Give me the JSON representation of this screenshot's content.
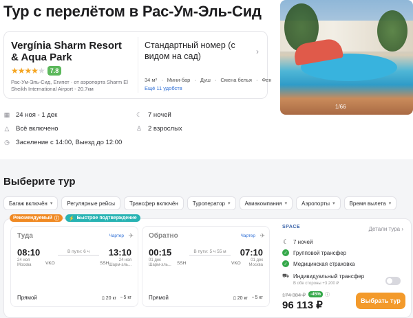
{
  "title": "Тур с перелётом в Рас-Ум-Эль-Сид",
  "hotel": {
    "name": "Vergínia Sharm Resort & Aqua Park",
    "stars": 4,
    "rating": "7.8",
    "location": "Рас-Ум-Эль-Сид, Египет · от аэропорта Sharm El Sheikh International Airport - 20.7км",
    "room": "Стандартный номер (с видом на сад)",
    "amenities": [
      "34 м²",
      "Мини-бар",
      "Душ",
      "Смена белья",
      "Фен"
    ],
    "more_amenities": "Ещё 11 удобств"
  },
  "photo_counter": "1/66",
  "facts": {
    "dates": "24 ноя - 1 дек",
    "meal": "Всё включено",
    "checkin": "Заселение с 14:00, Выезд до 12:00",
    "nights": "7 ночей",
    "guests": "2 взрослых"
  },
  "section_title": "Выберите тур",
  "filters": [
    {
      "label": "Багаж включён",
      "dropdown": true
    },
    {
      "label": "Регулярные рейсы",
      "dropdown": false
    },
    {
      "label": "Трансфер включён",
      "dropdown": false
    },
    {
      "label": "Туроператор",
      "dropdown": true
    },
    {
      "label": "Авиакомпания",
      "dropdown": true
    },
    {
      "label": "Аэропорты",
      "dropdown": true
    },
    {
      "label": "Время вылета",
      "dropdown": true
    }
  ],
  "badges": {
    "recommended": "Рекомендуемый",
    "fast": "Быстрое подтверждение"
  },
  "outbound": {
    "title": "Туда",
    "charter": "Чартер",
    "dep_time": "08:10",
    "arr_time": "13:10",
    "duration": "В пути: 6 ч",
    "dep_date": "24 ноя",
    "dep_city": "Москва",
    "arr_date": "24 ноя",
    "arr_city": "Шарм-эль...",
    "dep_airport": "VKO",
    "arr_airport": "SSH",
    "type": "Прямой",
    "bag1": "20 кг",
    "bag2": "5 кг"
  },
  "inbound": {
    "title": "Обратно",
    "charter": "Чартер",
    "dep_time": "00:15",
    "arr_time": "07:10",
    "duration": "В пути: 5 ч 55 м",
    "dep_date": "01 дек",
    "dep_city": "Шарм-эль...",
    "arr_date": "01 дек",
    "arr_city": "Москва",
    "dep_airport": "SSH",
    "arr_airport": "VKO",
    "type": "Прямой",
    "bag1": "20 кг",
    "bag2": "5 кг"
  },
  "offer": {
    "operator": "SPACE",
    "details": "Детали тура",
    "nights": "7 ночей",
    "group_transfer": "Групповой трансфер",
    "insurance": "Медицинская страховка",
    "individual_transfer": "Индивидуальный трансфер",
    "individual_sub": "В обе стороны +3 200 ₽",
    "old_price": "174 384 ₽",
    "discount": "-45%",
    "price": "96 113 ₽",
    "buy": "Выбрать тур"
  }
}
